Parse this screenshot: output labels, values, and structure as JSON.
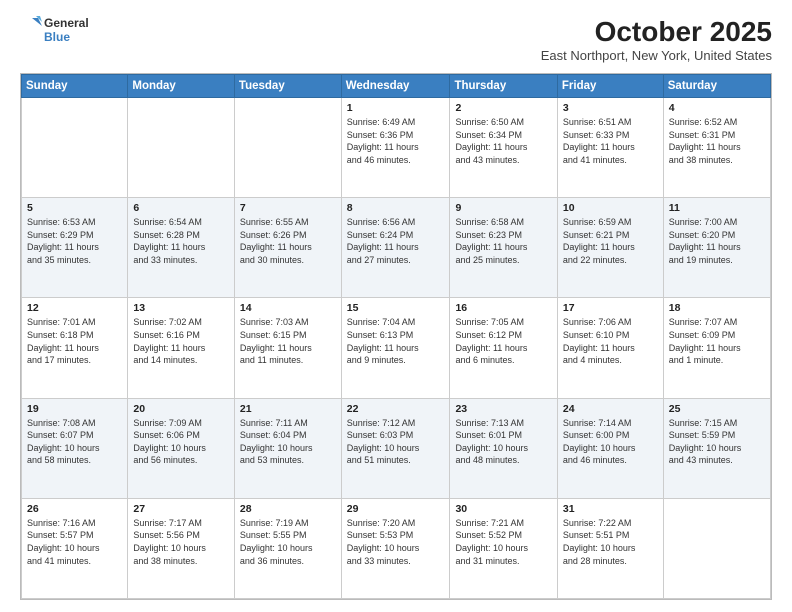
{
  "header": {
    "logo_general": "General",
    "logo_blue": "Blue",
    "title": "October 2025",
    "subtitle": "East Northport, New York, United States"
  },
  "calendar": {
    "weekdays": [
      "Sunday",
      "Monday",
      "Tuesday",
      "Wednesday",
      "Thursday",
      "Friday",
      "Saturday"
    ],
    "rows": [
      [
        {
          "num": "",
          "info": ""
        },
        {
          "num": "",
          "info": ""
        },
        {
          "num": "",
          "info": ""
        },
        {
          "num": "1",
          "info": "Sunrise: 6:49 AM\nSunset: 6:36 PM\nDaylight: 11 hours\nand 46 minutes."
        },
        {
          "num": "2",
          "info": "Sunrise: 6:50 AM\nSunset: 6:34 PM\nDaylight: 11 hours\nand 43 minutes."
        },
        {
          "num": "3",
          "info": "Sunrise: 6:51 AM\nSunset: 6:33 PM\nDaylight: 11 hours\nand 41 minutes."
        },
        {
          "num": "4",
          "info": "Sunrise: 6:52 AM\nSunset: 6:31 PM\nDaylight: 11 hours\nand 38 minutes."
        }
      ],
      [
        {
          "num": "5",
          "info": "Sunrise: 6:53 AM\nSunset: 6:29 PM\nDaylight: 11 hours\nand 35 minutes."
        },
        {
          "num": "6",
          "info": "Sunrise: 6:54 AM\nSunset: 6:28 PM\nDaylight: 11 hours\nand 33 minutes."
        },
        {
          "num": "7",
          "info": "Sunrise: 6:55 AM\nSunset: 6:26 PM\nDaylight: 11 hours\nand 30 minutes."
        },
        {
          "num": "8",
          "info": "Sunrise: 6:56 AM\nSunset: 6:24 PM\nDaylight: 11 hours\nand 27 minutes."
        },
        {
          "num": "9",
          "info": "Sunrise: 6:58 AM\nSunset: 6:23 PM\nDaylight: 11 hours\nand 25 minutes."
        },
        {
          "num": "10",
          "info": "Sunrise: 6:59 AM\nSunset: 6:21 PM\nDaylight: 11 hours\nand 22 minutes."
        },
        {
          "num": "11",
          "info": "Sunrise: 7:00 AM\nSunset: 6:20 PM\nDaylight: 11 hours\nand 19 minutes."
        }
      ],
      [
        {
          "num": "12",
          "info": "Sunrise: 7:01 AM\nSunset: 6:18 PM\nDaylight: 11 hours\nand 17 minutes."
        },
        {
          "num": "13",
          "info": "Sunrise: 7:02 AM\nSunset: 6:16 PM\nDaylight: 11 hours\nand 14 minutes."
        },
        {
          "num": "14",
          "info": "Sunrise: 7:03 AM\nSunset: 6:15 PM\nDaylight: 11 hours\nand 11 minutes."
        },
        {
          "num": "15",
          "info": "Sunrise: 7:04 AM\nSunset: 6:13 PM\nDaylight: 11 hours\nand 9 minutes."
        },
        {
          "num": "16",
          "info": "Sunrise: 7:05 AM\nSunset: 6:12 PM\nDaylight: 11 hours\nand 6 minutes."
        },
        {
          "num": "17",
          "info": "Sunrise: 7:06 AM\nSunset: 6:10 PM\nDaylight: 11 hours\nand 4 minutes."
        },
        {
          "num": "18",
          "info": "Sunrise: 7:07 AM\nSunset: 6:09 PM\nDaylight: 11 hours\nand 1 minute."
        }
      ],
      [
        {
          "num": "19",
          "info": "Sunrise: 7:08 AM\nSunset: 6:07 PM\nDaylight: 10 hours\nand 58 minutes."
        },
        {
          "num": "20",
          "info": "Sunrise: 7:09 AM\nSunset: 6:06 PM\nDaylight: 10 hours\nand 56 minutes."
        },
        {
          "num": "21",
          "info": "Sunrise: 7:11 AM\nSunset: 6:04 PM\nDaylight: 10 hours\nand 53 minutes."
        },
        {
          "num": "22",
          "info": "Sunrise: 7:12 AM\nSunset: 6:03 PM\nDaylight: 10 hours\nand 51 minutes."
        },
        {
          "num": "23",
          "info": "Sunrise: 7:13 AM\nSunset: 6:01 PM\nDaylight: 10 hours\nand 48 minutes."
        },
        {
          "num": "24",
          "info": "Sunrise: 7:14 AM\nSunset: 6:00 PM\nDaylight: 10 hours\nand 46 minutes."
        },
        {
          "num": "25",
          "info": "Sunrise: 7:15 AM\nSunset: 5:59 PM\nDaylight: 10 hours\nand 43 minutes."
        }
      ],
      [
        {
          "num": "26",
          "info": "Sunrise: 7:16 AM\nSunset: 5:57 PM\nDaylight: 10 hours\nand 41 minutes."
        },
        {
          "num": "27",
          "info": "Sunrise: 7:17 AM\nSunset: 5:56 PM\nDaylight: 10 hours\nand 38 minutes."
        },
        {
          "num": "28",
          "info": "Sunrise: 7:19 AM\nSunset: 5:55 PM\nDaylight: 10 hours\nand 36 minutes."
        },
        {
          "num": "29",
          "info": "Sunrise: 7:20 AM\nSunset: 5:53 PM\nDaylight: 10 hours\nand 33 minutes."
        },
        {
          "num": "30",
          "info": "Sunrise: 7:21 AM\nSunset: 5:52 PM\nDaylight: 10 hours\nand 31 minutes."
        },
        {
          "num": "31",
          "info": "Sunrise: 7:22 AM\nSunset: 5:51 PM\nDaylight: 10 hours\nand 28 minutes."
        },
        {
          "num": "",
          "info": ""
        }
      ]
    ]
  }
}
